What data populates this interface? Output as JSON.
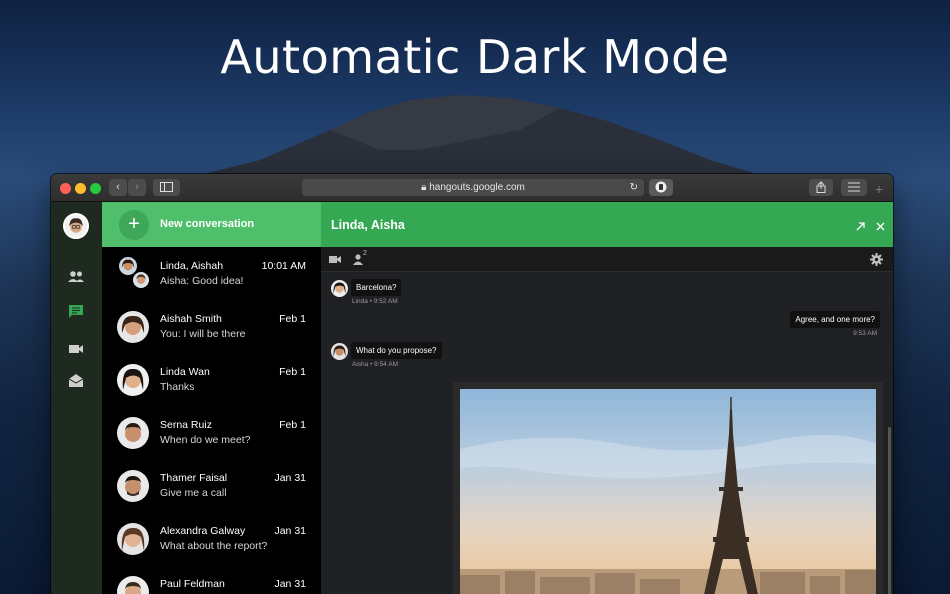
{
  "headline": "Automatic Dark Mode",
  "browser": {
    "url": "hangouts.google.com",
    "lock_icon": "lock-icon",
    "colors": {
      "close": "#ff5f57",
      "minimize": "#febc2e",
      "zoom": "#28c840"
    }
  },
  "app": {
    "accent": "#34a853",
    "new_conversation_label": "New conversation",
    "rail_icons": [
      "people-icon",
      "chat-icon",
      "video-icon",
      "inbox-icon"
    ],
    "conversations": [
      {
        "name": "Linda, Aishah",
        "message": "Aisha: Good idea!",
        "date": "10:01 AM"
      },
      {
        "name": "Aishah Smith",
        "message": "You: I will be there",
        "date": "Feb 1"
      },
      {
        "name": "Linda Wan",
        "message": "Thanks",
        "date": "Feb 1"
      },
      {
        "name": "Serna Ruiz",
        "message": "When do we meet?",
        "date": "Feb 1"
      },
      {
        "name": "Thamer Faisal",
        "message": "Give me a call",
        "date": "Jan 31"
      },
      {
        "name": "Alexandra Galway",
        "message": "What about the report?",
        "date": "Jan 31"
      },
      {
        "name": "Paul Feldman",
        "message": "",
        "date": "Jan 31"
      }
    ],
    "chat": {
      "title": "Linda, Aisha",
      "participants_count": "2",
      "messages": [
        {
          "text": "Barcelona?",
          "meta": "Linda • 9:52 AM",
          "side": "left"
        },
        {
          "text": "Agree, and one more?",
          "meta": "9:53 AM",
          "side": "right"
        },
        {
          "text": "What do you propose?",
          "meta": "Aisha • 9:54 AM",
          "side": "left"
        }
      ]
    }
  }
}
